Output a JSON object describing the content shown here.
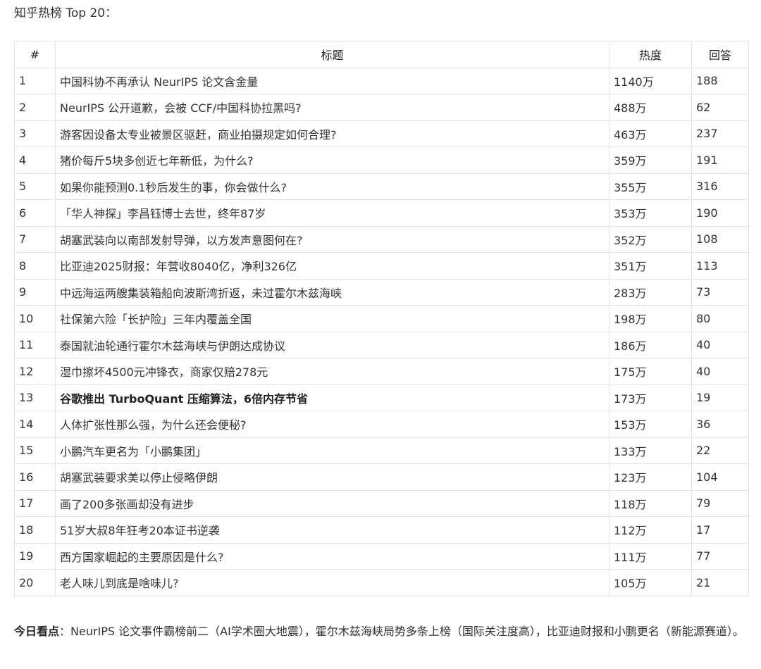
{
  "intro": "知乎热榜 Top 20：",
  "table": {
    "headers": {
      "rank": "#",
      "title": "标题",
      "heat": "热度",
      "answers": "回答"
    },
    "rows": [
      {
        "rank": "1",
        "title": "中国科协不再承认 NeurIPS 论文含金量",
        "heat": "1140万",
        "answers": "188"
      },
      {
        "rank": "2",
        "title": "NeurIPS 公开道歉，会被 CCF/中国科协拉黑吗?",
        "heat": "488万",
        "answers": "62"
      },
      {
        "rank": "3",
        "title": "游客因设备太专业被景区驱赶，商业拍摄规定如何合理?",
        "heat": "463万",
        "answers": "237"
      },
      {
        "rank": "4",
        "title": "猪价每斤5块多创近七年新低，为什么?",
        "heat": "359万",
        "answers": "191"
      },
      {
        "rank": "5",
        "title": "如果你能预测0.1秒后发生的事，你会做什么?",
        "heat": "355万",
        "answers": "316"
      },
      {
        "rank": "6",
        "title": "「华人神探」李昌钰博士去世，终年87岁",
        "heat": "353万",
        "answers": "190"
      },
      {
        "rank": "7",
        "title": "胡塞武装向以南部发射导弹，以方发声意图何在?",
        "heat": "352万",
        "answers": "108"
      },
      {
        "rank": "8",
        "title": "比亚迪2025财报：年营收8040亿，净利326亿",
        "heat": "351万",
        "answers": "113"
      },
      {
        "rank": "9",
        "title": "中远海运两艘集装箱船向波斯湾折返，未过霍尔木兹海峡",
        "heat": "283万",
        "answers": "73"
      },
      {
        "rank": "10",
        "title": "社保第六险「长护险」三年内覆盖全国",
        "heat": "198万",
        "answers": "80"
      },
      {
        "rank": "11",
        "title": "泰国就油轮通行霍尔木兹海峡与伊朗达成协议",
        "heat": "186万",
        "answers": "40"
      },
      {
        "rank": "12",
        "title": "湿巾擦坏4500元冲锋衣，商家仅赔278元",
        "heat": "175万",
        "answers": "40"
      },
      {
        "rank": "13",
        "title": "谷歌推出 TurboQuant 压缩算法，6倍内存节省",
        "heat": "173万",
        "answers": "19",
        "bold": true
      },
      {
        "rank": "14",
        "title": "人体扩张性那么强，为什么还会便秘?",
        "heat": "153万",
        "answers": "36"
      },
      {
        "rank": "15",
        "title": "小鹏汽车更名为「小鹏集团」",
        "heat": "133万",
        "answers": "22"
      },
      {
        "rank": "16",
        "title": "胡塞武装要求美以停止侵略伊朗",
        "heat": "123万",
        "answers": "104"
      },
      {
        "rank": "17",
        "title": "画了200多张画却没有进步",
        "heat": "118万",
        "answers": "79"
      },
      {
        "rank": "18",
        "title": "51岁大叔8年狂考20本证书逆袭",
        "heat": "112万",
        "answers": "17"
      },
      {
        "rank": "19",
        "title": "西方国家崛起的主要原因是什么?",
        "heat": "111万",
        "answers": "77"
      },
      {
        "rank": "20",
        "title": "老人味儿到底是啥味儿?",
        "heat": "105万",
        "answers": "21"
      }
    ]
  },
  "summary": {
    "lead": "今日看点",
    "text": "：NeurIPS 论文事件霸榜前二（AI学术圈大地震），霍尔木兹海峡局势多条上榜（国际关注度高），比亚迪财报和小鹏更名（新能源赛道）。"
  }
}
